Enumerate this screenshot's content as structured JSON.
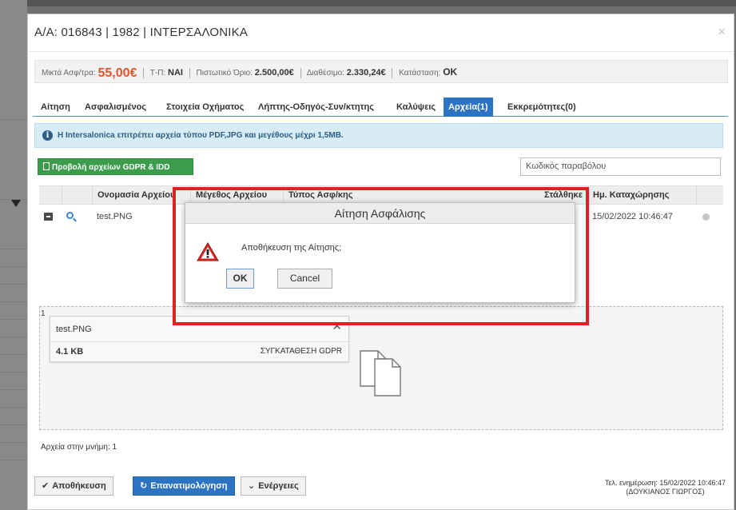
{
  "window": {
    "title": "Α/Α: 016843 | 1982 | ΙΝΤΕΡΣΑΛΟΝΙΚΑ",
    "close_icon": "close-icon"
  },
  "info_bar": {
    "gross_label": "Μικτά Ασφ/τρα:",
    "gross_value": "55,00€",
    "tp_label": "Τ-Π:",
    "tp_value": "ΝΑΙ",
    "credit_label": "Πιστωτικό Όριο:",
    "credit_value": "2.500,00€",
    "available_label": "Διαθέσιμο:",
    "available_value": "2.330,24€",
    "status_label": "Κατάσταση:",
    "status_value": "OK"
  },
  "tabs": [
    {
      "label": "Αίτηση"
    },
    {
      "label": "Ασφαλισμένος"
    },
    {
      "label": "Στοιχεία Οχήματος"
    },
    {
      "label": "Λήπτης-Οδηγός-Συν/κτητης"
    },
    {
      "label": "Καλύψεις"
    },
    {
      "label": "Αρχεία(1)",
      "active": true
    },
    {
      "label": "Εκκρεμότητες(0)"
    }
  ],
  "alert": {
    "icon": "info-icon",
    "text": "Η Intersalonica επιτρέπει αρχεία τύπου PDF,JPG και μεγέθους μέχρι 1,5MB."
  },
  "gdpr_button": {
    "label": "Προβολή αρχείων GDPR & IDD"
  },
  "search": {
    "placeholder": "Κωδικός παραβόλου"
  },
  "grid": {
    "columns": [
      "Ονομασία Αρχείου",
      "Μέγεθος Αρχείου",
      "Τύπος Ασφ/κης",
      "Στάλθηκε",
      "Ημ. Καταχώρησης"
    ],
    "rows": [
      {
        "name": "test.PNG",
        "date": "15/02/2022 10:46:47"
      }
    ]
  },
  "drop_zone": {
    "index": "1",
    "file": {
      "name": "test.PNG",
      "size": "4.1 KB",
      "category": "ΣΥΓΚΑΤΑΘΕΣΗ GDPR"
    },
    "memory_label": "Αρχεία στην μνήμη: 1"
  },
  "footer": {
    "save": "Αποθήκευση",
    "recalc": "Επανατιμολόγηση",
    "actions": "Ενέργειες",
    "last_update": "Τελ. ενημέρωση: 15/02/2022 10:46:47",
    "last_update_user": "(ΔΟΥΚΙΑΝΟΣ ΓΙΩΡΓΟΣ)"
  },
  "modal": {
    "title": "Αίτηση Ασφάλισης",
    "message": "Αποθήκευση της Αίτησης;",
    "ok": "OK",
    "cancel": "Cancel"
  },
  "colors": {
    "accent": "#2d73c4",
    "gross_value": "#e8542a",
    "gdpr_button": "#3d9b4c",
    "highlight": "#e02025"
  }
}
